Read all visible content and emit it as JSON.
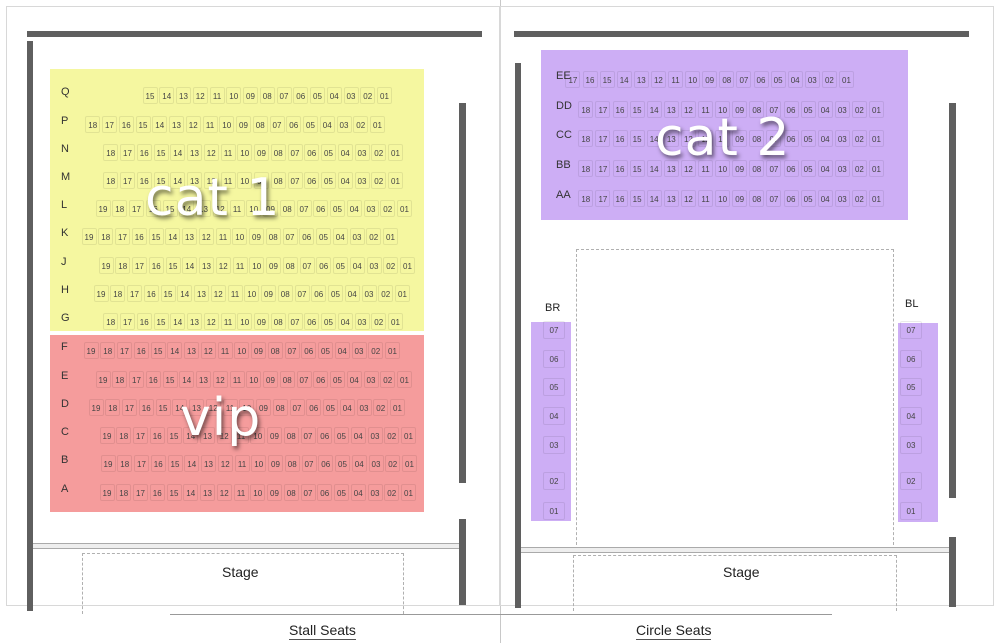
{
  "colors": {
    "cat1": "#f5f7a0",
    "vip": "#f59c9c",
    "cat2": "#cdaef5",
    "wall": "#5f5f5f"
  },
  "stall": {
    "caption": "Stall Seats",
    "stage_label": "Stage",
    "zones": [
      {
        "name": "cat 1",
        "label": "cat 1"
      },
      {
        "name": "vip",
        "label": "vip"
      }
    ],
    "rows": [
      {
        "row": "Q",
        "zone": "cat1",
        "seats": [
          "15",
          "14",
          "13",
          "12",
          "11",
          "10",
          "09",
          "08",
          "07",
          "06",
          "05",
          "04",
          "03",
          "02",
          "01"
        ]
      },
      {
        "row": "P",
        "zone": "cat1",
        "seats": [
          "18",
          "17",
          "16",
          "15",
          "14",
          "13",
          "12",
          "11",
          "10",
          "09",
          "08",
          "07",
          "06",
          "05",
          "04",
          "03",
          "02",
          "01"
        ]
      },
      {
        "row": "N",
        "zone": "cat1",
        "seats": [
          "18",
          "17",
          "16",
          "15",
          "14",
          "13",
          "12",
          "11",
          "10",
          "09",
          "08",
          "07",
          "06",
          "05",
          "04",
          "03",
          "02",
          "01"
        ]
      },
      {
        "row": "M",
        "zone": "cat1",
        "seats": [
          "18",
          "17",
          "16",
          "15",
          "14",
          "13",
          "12",
          "11",
          "10",
          "09",
          "08",
          "07",
          "06",
          "05",
          "04",
          "03",
          "02",
          "01"
        ]
      },
      {
        "row": "L",
        "zone": "cat1",
        "seats": [
          "19",
          "18",
          "17",
          "16",
          "15",
          "14",
          "13",
          "12",
          "11",
          "10",
          "09",
          "08",
          "07",
          "06",
          "05",
          "04",
          "03",
          "02",
          "01"
        ]
      },
      {
        "row": "K",
        "zone": "cat1",
        "seats": [
          "19",
          "18",
          "17",
          "16",
          "15",
          "14",
          "13",
          "12",
          "11",
          "10",
          "09",
          "08",
          "07",
          "06",
          "05",
          "04",
          "03",
          "02",
          "01"
        ]
      },
      {
        "row": "J",
        "zone": "cat1",
        "seats": [
          "19",
          "18",
          "17",
          "16",
          "15",
          "14",
          "13",
          "12",
          "11",
          "10",
          "09",
          "08",
          "07",
          "06",
          "05",
          "04",
          "03",
          "02",
          "01"
        ]
      },
      {
        "row": "H",
        "zone": "cat1",
        "seats": [
          "19",
          "18",
          "17",
          "16",
          "15",
          "14",
          "13",
          "12",
          "11",
          "10",
          "09",
          "08",
          "07",
          "06",
          "05",
          "04",
          "03",
          "02",
          "01"
        ]
      },
      {
        "row": "G",
        "zone": "cat1",
        "seats": [
          "18",
          "17",
          "16",
          "15",
          "14",
          "13",
          "12",
          "11",
          "10",
          "09",
          "08",
          "07",
          "06",
          "05",
          "04",
          "03",
          "02",
          "01"
        ]
      },
      {
        "row": "F",
        "zone": "vip",
        "seats": [
          "19",
          "18",
          "17",
          "16",
          "15",
          "14",
          "13",
          "12",
          "11",
          "10",
          "09",
          "08",
          "07",
          "06",
          "05",
          "04",
          "03",
          "02",
          "01"
        ]
      },
      {
        "row": "E",
        "zone": "vip",
        "seats": [
          "19",
          "18",
          "17",
          "16",
          "15",
          "14",
          "13",
          "12",
          "11",
          "10",
          "09",
          "08",
          "07",
          "06",
          "05",
          "04",
          "03",
          "02",
          "01"
        ]
      },
      {
        "row": "D",
        "zone": "vip",
        "seats": [
          "19",
          "18",
          "17",
          "16",
          "15",
          "14",
          "13",
          "12",
          "11",
          "10",
          "09",
          "08",
          "07",
          "06",
          "05",
          "04",
          "03",
          "02",
          "01"
        ]
      },
      {
        "row": "C",
        "zone": "vip",
        "seats": [
          "19",
          "18",
          "17",
          "16",
          "15",
          "14",
          "13",
          "12",
          "11",
          "10",
          "09",
          "08",
          "07",
          "06",
          "05",
          "04",
          "03",
          "02",
          "01"
        ]
      },
      {
        "row": "B",
        "zone": "vip",
        "seats": [
          "19",
          "18",
          "17",
          "16",
          "15",
          "14",
          "13",
          "12",
          "11",
          "10",
          "09",
          "08",
          "07",
          "06",
          "05",
          "04",
          "03",
          "02",
          "01"
        ]
      },
      {
        "row": "A",
        "zone": "vip",
        "seats": [
          "19",
          "18",
          "17",
          "16",
          "15",
          "14",
          "13",
          "12",
          "11",
          "10",
          "09",
          "08",
          "07",
          "06",
          "05",
          "04",
          "03",
          "02",
          "01"
        ]
      }
    ]
  },
  "circle": {
    "caption": "Circle Seats",
    "stage_label": "Stage",
    "zone_label": "cat 2",
    "rows": [
      {
        "row": "EE",
        "seats": [
          "17",
          "16",
          "15",
          "14",
          "13",
          "12",
          "11",
          "10",
          "09",
          "08",
          "07",
          "06",
          "05",
          "04",
          "03",
          "02",
          "01"
        ]
      },
      {
        "row": "DD",
        "seats": [
          "18",
          "17",
          "16",
          "15",
          "14",
          "13",
          "12",
          "11",
          "10",
          "09",
          "08",
          "07",
          "06",
          "05",
          "04",
          "03",
          "02",
          "01"
        ]
      },
      {
        "row": "CC",
        "seats": [
          "18",
          "17",
          "16",
          "15",
          "14",
          "13",
          "12",
          "11",
          "10",
          "09",
          "08",
          "07",
          "06",
          "05",
          "04",
          "03",
          "02",
          "01"
        ]
      },
      {
        "row": "BB",
        "seats": [
          "18",
          "17",
          "16",
          "15",
          "14",
          "13",
          "12",
          "11",
          "10",
          "09",
          "08",
          "07",
          "06",
          "05",
          "04",
          "03",
          "02",
          "01"
        ]
      },
      {
        "row": "AA",
        "seats": [
          "18",
          "17",
          "16",
          "15",
          "14",
          "13",
          "12",
          "11",
          "10",
          "09",
          "08",
          "07",
          "06",
          "05",
          "04",
          "03",
          "02",
          "01"
        ]
      }
    ],
    "boxes": [
      {
        "name": "BR",
        "seats": [
          "07",
          "06",
          "05",
          "04",
          "03",
          "02",
          "01"
        ]
      },
      {
        "name": "BL",
        "seats": [
          "07",
          "06",
          "05",
          "04",
          "03",
          "02",
          "01"
        ]
      }
    ]
  }
}
